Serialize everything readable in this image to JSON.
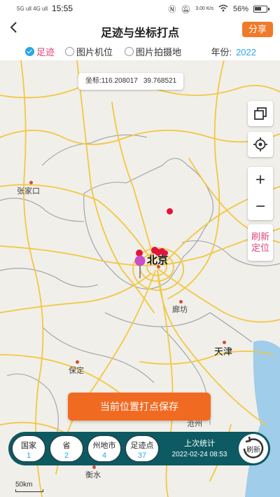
{
  "statusbar": {
    "signal_text": "5G ull 4G ull",
    "time": "15:55",
    "net_speed": "3.00 K/s",
    "battery": "56%"
  },
  "header": {
    "title": "足迹与坐标打点",
    "share_label": "分享"
  },
  "filters": {
    "options": [
      {
        "label": "足迹",
        "selected": true
      },
      {
        "label": "图片机位",
        "selected": false
      },
      {
        "label": "图片拍摄地",
        "selected": false
      }
    ],
    "year_label": "年份:",
    "year_value": "2022"
  },
  "map": {
    "coordinate_text": "坐标:116.208017",
    "coordinate_lat": "39.768521",
    "places": {
      "zhangjiakou": "张家口",
      "beijing": "北京",
      "langfang": "廊坊",
      "tianjin": "天津",
      "baoding": "保定",
      "hengshui": "衡水",
      "cangzhou": "沧州"
    },
    "controls": {
      "zoom_in": "+",
      "zoom_out": "−",
      "refresh_line1": "刷新",
      "refresh_line2": "定位"
    },
    "scale_label": "50km"
  },
  "save_button": "当前位置打点保存",
  "stats": {
    "items": [
      {
        "label": "国家",
        "value": "1"
      },
      {
        "label": "省",
        "value": "2"
      },
      {
        "label": "州地市",
        "value": "4"
      },
      {
        "label": "足迹点",
        "value": "37"
      }
    ],
    "last_label": "上次统计",
    "last_time": "2022-02-24 08:53",
    "refresh_label": "刷新"
  }
}
